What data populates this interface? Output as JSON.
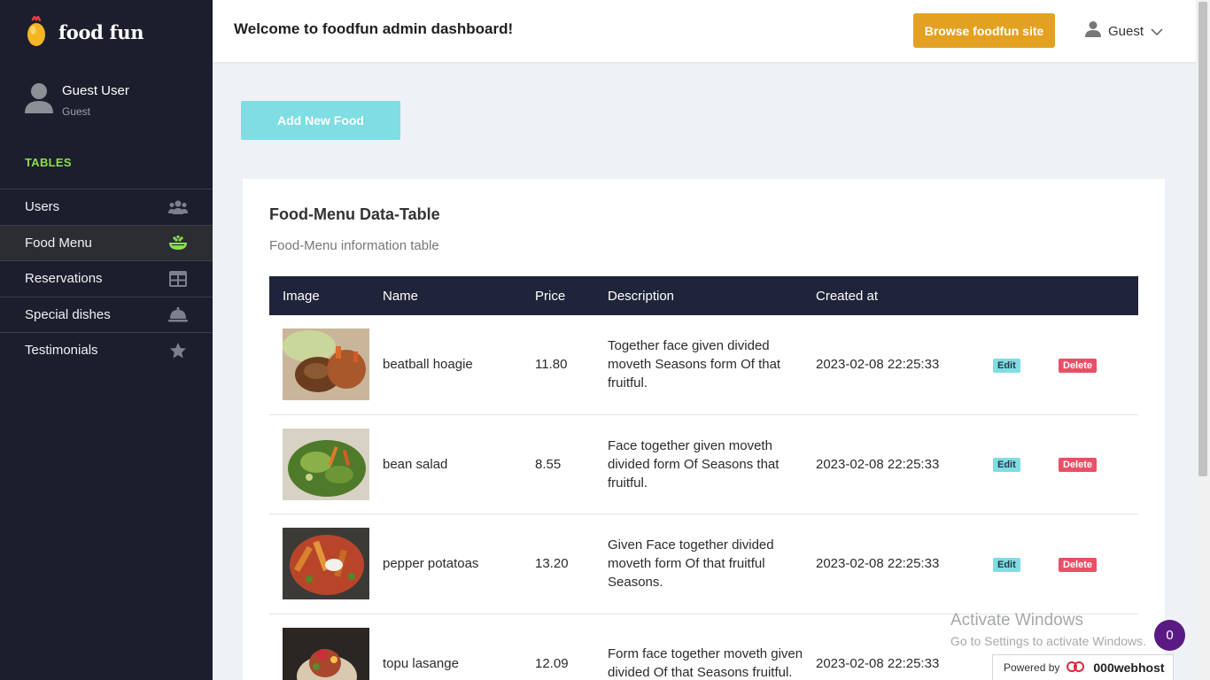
{
  "brand": {
    "name": "food fun"
  },
  "user": {
    "name": "Guest User",
    "role": "Guest"
  },
  "sidebar": {
    "section_title": "TABLES",
    "items": [
      {
        "label": "Users",
        "icon": "users-icon"
      },
      {
        "label": "Food Menu",
        "icon": "food-bowl-icon",
        "active": true
      },
      {
        "label": "Reservations",
        "icon": "table-icon"
      },
      {
        "label": "Special dishes",
        "icon": "serving-bell-icon"
      },
      {
        "label": "Testimonials",
        "icon": "star-icon"
      }
    ]
  },
  "header": {
    "welcome": "Welcome to foodfun admin dashboard!",
    "browse_label": "Browse foodfun site",
    "account_label": "Guest"
  },
  "main": {
    "add_button_label": "Add New Food",
    "card_title": "Food-Menu Data-Table",
    "card_subtitle": "Food-Menu information table",
    "columns": [
      "Image",
      "Name",
      "Price",
      "Description",
      "Created at"
    ],
    "edit_label": "Edit",
    "delete_label": "Delete",
    "rows": [
      {
        "name": "beatball hoagie",
        "price": "11.80",
        "description": "Together face given divided moveth Seasons form Of that fruitful.",
        "created_at": "2023-02-08 22:25:33"
      },
      {
        "name": "bean salad",
        "price": "8.55",
        "description": "Face together given moveth divided form Of Seasons that fruitful.",
        "created_at": "2023-02-08 22:25:33"
      },
      {
        "name": "pepper potatoas",
        "price": "13.20",
        "description": "Given Face together divided moveth form Of that fruitful Seasons.",
        "created_at": "2023-02-08 22:25:33"
      },
      {
        "name": "topu lasange",
        "price": "12.09",
        "description": "Form face together moveth given divided Of that Seasons fruitful.",
        "created_at": "2023-02-08 22:25:33"
      }
    ]
  },
  "overlay": {
    "activate_title": "Activate Windows",
    "activate_sub": "Go to Settings to activate Windows.",
    "chat_count": "0",
    "powered_by": "Powered by",
    "powered_brand": "000webhost"
  },
  "colors": {
    "sidebar_bg": "#1c1e2d",
    "accent_orange": "#e3a121",
    "accent_cyan": "#7fdde3",
    "delete_red": "#e94f66",
    "section_green": "#8ee04b",
    "table_header": "#20243a"
  }
}
